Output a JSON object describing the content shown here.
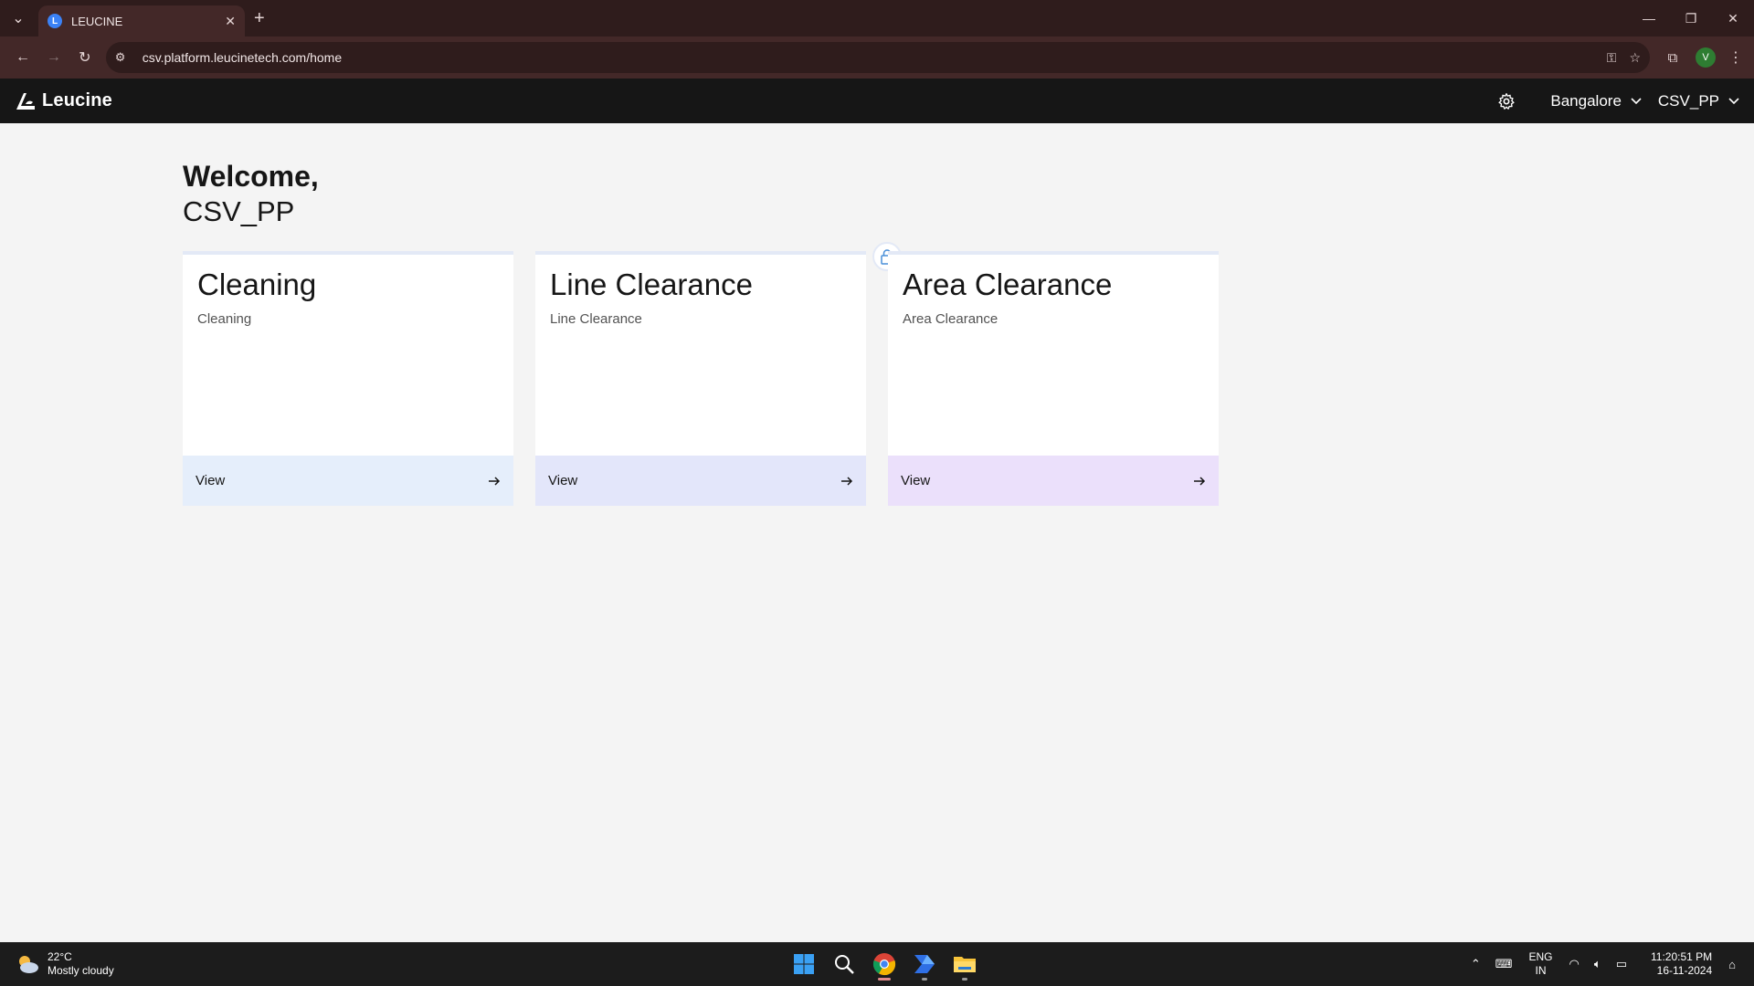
{
  "browser": {
    "tab_title": "LEUCINE",
    "url": "csv.platform.leucinetech.com/home",
    "profile_initial": "V"
  },
  "app": {
    "brand": "Leucine",
    "location": "Bangalore",
    "user": "CSV_PP"
  },
  "welcome": {
    "greeting": "Welcome,",
    "username": "CSV_PP"
  },
  "cards": [
    {
      "title": "Cleaning",
      "subtitle": "Cleaning",
      "action": "View",
      "footer_color": "#e5eefb"
    },
    {
      "title": "Line Clearance",
      "subtitle": "Line Clearance",
      "action": "View",
      "footer_color": "#e3e6fa"
    },
    {
      "title": "Area Clearance",
      "subtitle": "Area Clearance",
      "action": "View",
      "footer_color": "#ebe0fb"
    }
  ],
  "taskbar": {
    "temperature": "22°C",
    "weather": "Mostly cloudy",
    "lang_line1": "ENG",
    "lang_line2": "IN",
    "time": "11:20:51 PM",
    "date": "16-11-2024"
  },
  "colors": {
    "header_bg": "#161616",
    "page_bg": "#f4f4f4",
    "chrome_bg": "#432828"
  }
}
